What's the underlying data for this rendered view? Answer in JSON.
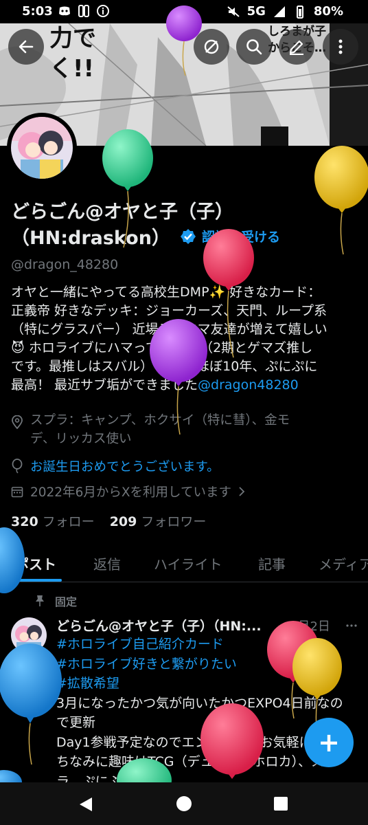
{
  "status_bar": {
    "time": "5:03",
    "network": "5G",
    "battery": "80%"
  },
  "header": {
    "banner_text_left": "力で\nく!!",
    "banner_text_right": "しろまが子\nからこそ…"
  },
  "profile": {
    "name_line1": "どらごん@オヤと子（子）",
    "name_line2": "（HN:draskon）",
    "verify_label": "認証を受ける",
    "handle": "@dragon_48280",
    "bio": [
      "オヤと一緒にやってる高校生DMP✨ 好きなカード：",
      "正義帝 好きなデッキ：ジョーカーズ、天門、ループ系",
      "（特にグラスパー） 近場デュエマ友達が増えて嬉しい",
      "😈 ホロライブにハマってます。 （2期とゲマズ推し",
      "です。最推しはスバル） ぷに歴ほぼ10年、ぷにぷに",
      "最高！ 最近サブ垢ができました"
    ],
    "bio_link": "@dragon48280",
    "location_line1": "スプラ：キャンプ、ホクサイ（特に彗）、金モ",
    "location_line2": "デ、リッカス使い",
    "birthday": "お誕生日おめでとうございます。",
    "joined": "2022年6月からXを利用しています",
    "following_count": "320",
    "following_label": "フォロー",
    "followers_count": "209",
    "followers_label": "フォロワー"
  },
  "tabs": [
    {
      "label": "ポスト"
    },
    {
      "label": "返信"
    },
    {
      "label": "ハイライト"
    },
    {
      "label": "記事"
    },
    {
      "label": "メディア"
    }
  ],
  "pinned_post": {
    "pinned_label": "固定",
    "author": "どらごん@オヤと子（子）（HN:...",
    "date": "3月2日",
    "hashtags": [
      "#ホロライブ自己紹介カード",
      "#ホロライブ好きと繋がりたい",
      "#拡散希望"
    ],
    "lines": [
      "3月になったかつ気が向いたかつEXPO4日前なの",
      "で更新",
      "Day1参戦予定なのでエンカなどはお気軽に",
      "ちなみに趣味はTCG（デュエマとホロカ）、スプ",
      "ラ、ぷにぷにです。"
    ]
  },
  "fab": {
    "label": "+"
  },
  "icons": {
    "back": "back-arrow-icon",
    "hide": "eye-off-icon",
    "search": "search-icon",
    "edit": "pencil-icon",
    "more": "more-vertical-icon"
  },
  "colors": {
    "accent": "#1d9bf0",
    "background": "#000000",
    "text": "#e7e9ea",
    "muted": "#71767b"
  }
}
